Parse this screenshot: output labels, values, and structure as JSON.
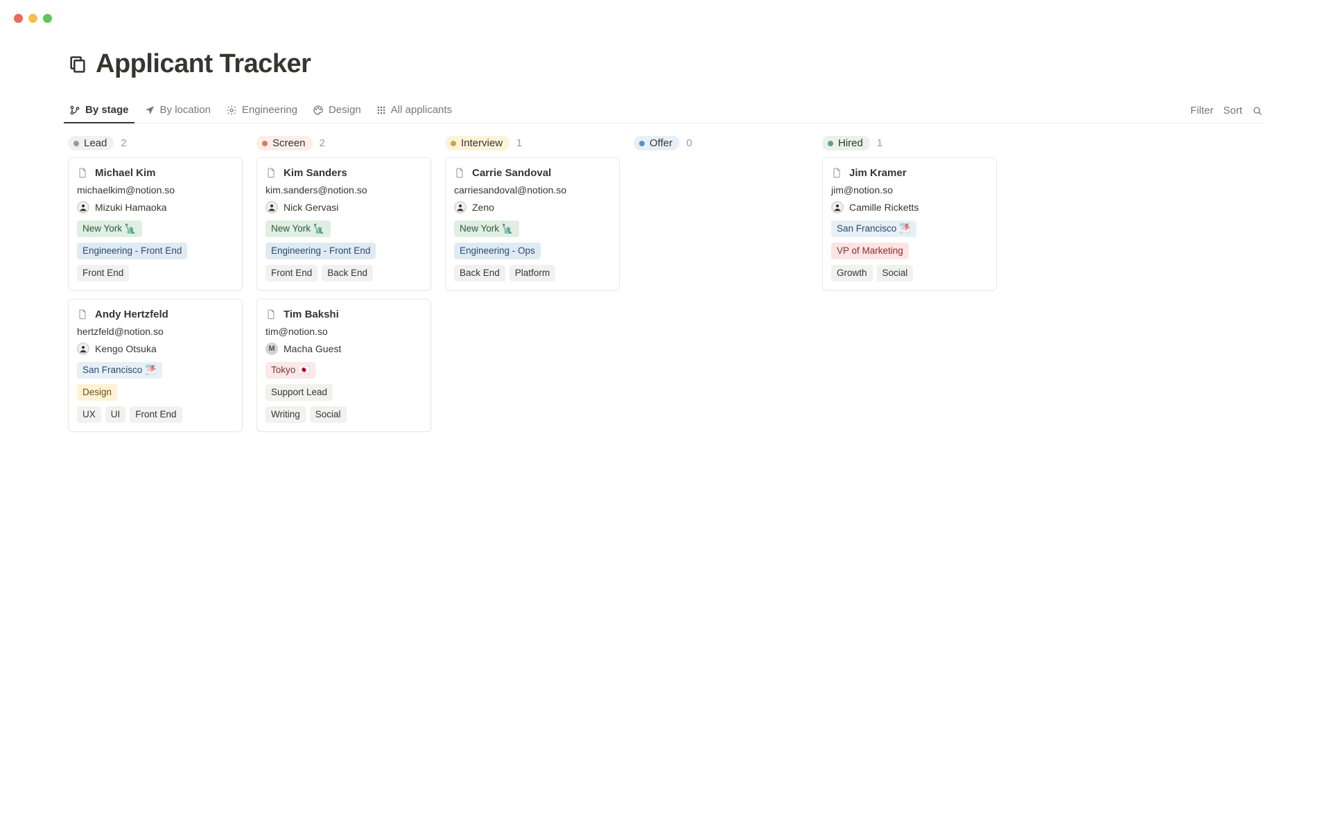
{
  "window": {
    "title": "Applicant Tracker"
  },
  "tabs": [
    {
      "label": "By stage",
      "icon": "branch-icon",
      "active": true
    },
    {
      "label": "By location",
      "icon": "location-arrow-icon",
      "active": false
    },
    {
      "label": "Engineering",
      "icon": "gear-icon",
      "active": false
    },
    {
      "label": "Design",
      "icon": "palette-icon",
      "active": false
    },
    {
      "label": "All applicants",
      "icon": "grid-icon",
      "active": false
    }
  ],
  "actions": {
    "filter": "Filter",
    "sort": "Sort"
  },
  "columns": [
    {
      "key": "lead",
      "label": "Lead",
      "count": 2,
      "badge": "lead",
      "cards": [
        {
          "name": "Michael Kim",
          "email": "michaelkim@notion.so",
          "owner": "Mizuki Hamaoka",
          "avatar": "face",
          "location": {
            "text": "New York 🗽",
            "style": "green"
          },
          "role": {
            "text": "Engineering - Front End",
            "style": "blue"
          },
          "tags": [
            {
              "text": "Front End",
              "style": "grey"
            }
          ]
        },
        {
          "name": "Andy Hertzfeld",
          "email": "hertzfeld@notion.so",
          "owner": "Kengo Otsuka",
          "avatar": "face",
          "location": {
            "text": "San Francisco 🌁",
            "style": "lblueTag"
          },
          "role": {
            "text": "Design",
            "style": "yellow"
          },
          "tags": [
            {
              "text": "UX",
              "style": "grey"
            },
            {
              "text": "UI",
              "style": "grey"
            },
            {
              "text": "Front End",
              "style": "grey"
            }
          ]
        }
      ]
    },
    {
      "key": "screen",
      "label": "Screen",
      "count": 2,
      "badge": "screen",
      "cards": [
        {
          "name": "Kim Sanders",
          "email": "kim.sanders@notion.so",
          "owner": "Nick Gervasi",
          "avatar": "face",
          "location": {
            "text": "New York 🗽",
            "style": "green"
          },
          "role": {
            "text": "Engineering - Front End",
            "style": "blue"
          },
          "tags": [
            {
              "text": "Front End",
              "style": "grey"
            },
            {
              "text": "Back End",
              "style": "grey"
            }
          ]
        },
        {
          "name": "Tim Bakshi",
          "email": "tim@notion.so",
          "owner": "Macha Guest",
          "avatar": "letter",
          "avatar_letter": "M",
          "location": {
            "text": "Tokyo 🇯🇵",
            "style": "pink"
          },
          "role": {
            "text": "Support Lead",
            "style": "grey"
          },
          "tags": [
            {
              "text": "Writing",
              "style": "grey"
            },
            {
              "text": "Social",
              "style": "grey"
            }
          ]
        }
      ]
    },
    {
      "key": "interview",
      "label": "Interview",
      "count": 1,
      "badge": "interview",
      "cards": [
        {
          "name": "Carrie Sandoval",
          "email": "carriesandoval@notion.so",
          "owner": "Zeno",
          "avatar": "face",
          "location": {
            "text": "New York 🗽",
            "style": "green"
          },
          "role": {
            "text": "Engineering - Ops",
            "style": "blue"
          },
          "tags": [
            {
              "text": "Back End",
              "style": "grey"
            },
            {
              "text": "Platform",
              "style": "grey"
            }
          ]
        }
      ]
    },
    {
      "key": "offer",
      "label": "Offer",
      "count": 0,
      "badge": "offer",
      "cards": []
    },
    {
      "key": "hired",
      "label": "Hired",
      "count": 1,
      "badge": "hired",
      "cards": [
        {
          "name": "Jim Kramer",
          "email": "jim@notion.so",
          "owner": "Camille Ricketts",
          "avatar": "face",
          "location": {
            "text": "San Francisco 🌁",
            "style": "lblueTag"
          },
          "role": {
            "text": "VP of Marketing",
            "style": "red"
          },
          "tags": [
            {
              "text": "Growth",
              "style": "grey"
            },
            {
              "text": "Social",
              "style": "grey"
            }
          ]
        }
      ]
    }
  ]
}
